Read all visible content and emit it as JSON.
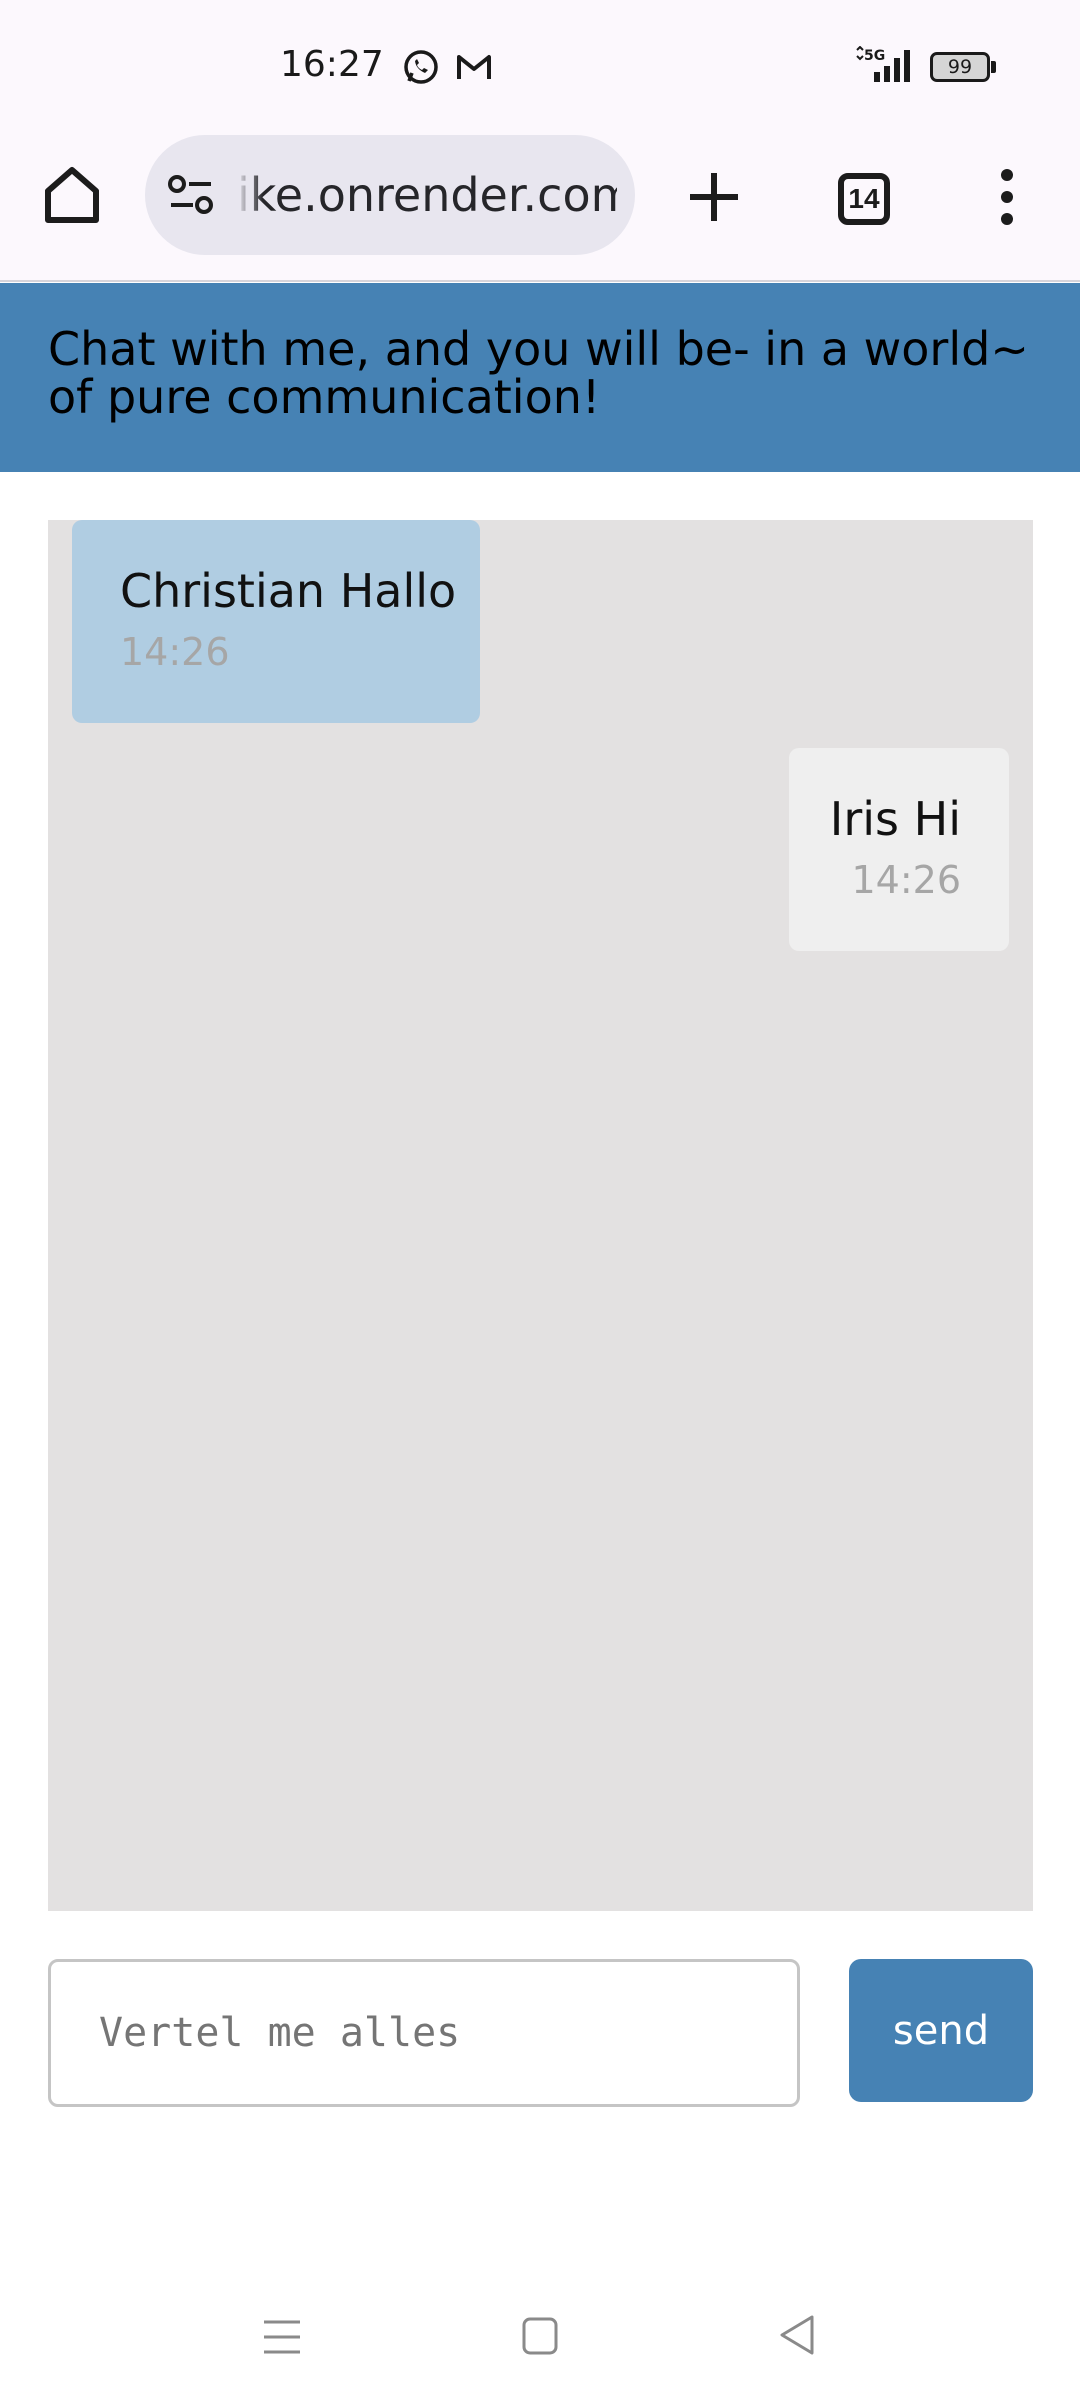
{
  "status_bar": {
    "time": "16:27",
    "network": "5G",
    "battery": "99",
    "icons": [
      "whatsapp-icon",
      "gmail-icon",
      "signal-icon",
      "battery-icon"
    ]
  },
  "browser": {
    "url": "ike.onrender.com",
    "tab_count": "14",
    "icons": [
      "home-icon",
      "site-settings-icon",
      "new-tab-icon",
      "tabs-icon",
      "menu-icon"
    ]
  },
  "header": {
    "title": "Chat with me, and you will be- in a world~ of pure communication!"
  },
  "chat": {
    "messages": [
      {
        "sender": "Christian",
        "text": "Christian Hallo",
        "time": "14:26",
        "side": "left"
      },
      {
        "sender": "Iris",
        "text": "Iris Hi",
        "time": "14:26",
        "side": "right"
      }
    ]
  },
  "composer": {
    "placeholder": "Vertel me alles",
    "value": "",
    "send_label": "send"
  },
  "nav": {
    "icons": [
      "recents-icon",
      "home-nav-icon",
      "back-icon"
    ]
  },
  "colors": {
    "header_bg": "#4682b4",
    "chat_bg": "#e3e1e1",
    "bubble_left": "#b0cde2",
    "bubble_right": "#efefef",
    "send_bg": "#4682b4"
  }
}
